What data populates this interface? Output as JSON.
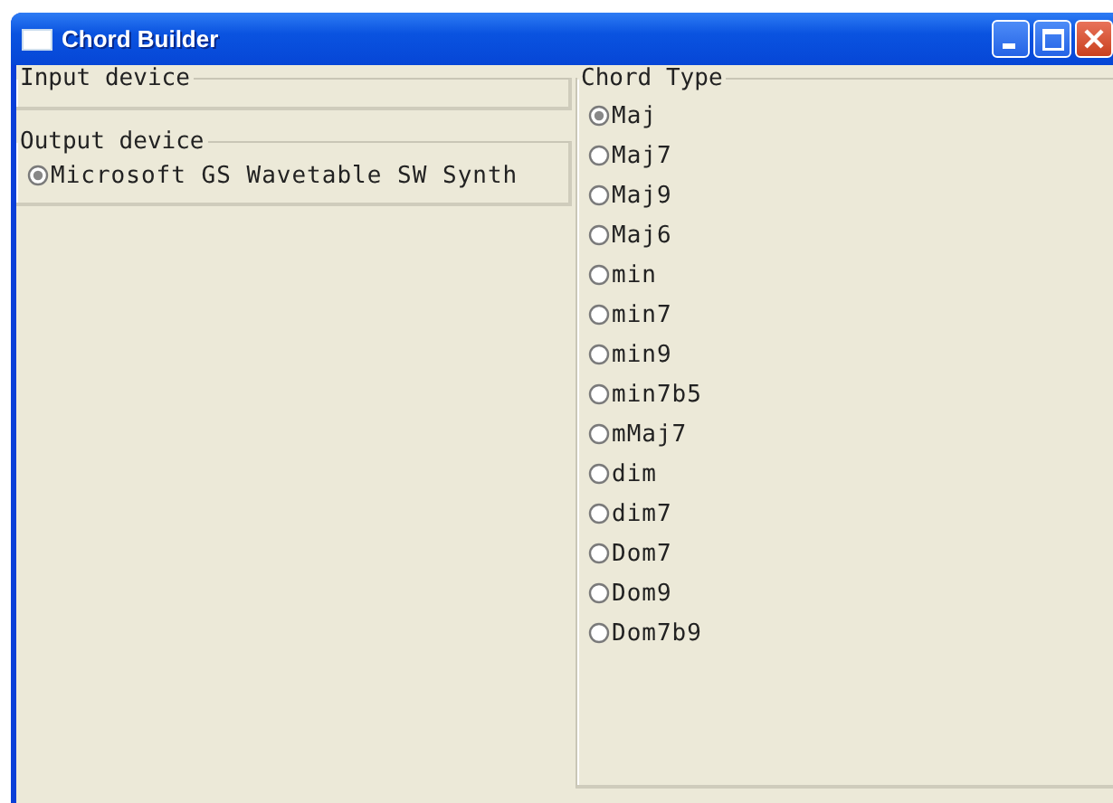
{
  "window": {
    "title": "Chord Builder"
  },
  "input_device": {
    "label": "Input device"
  },
  "output_device": {
    "label": "Output device",
    "options": [
      {
        "label": "Microsoft GS Wavetable SW Synth",
        "selected": true
      }
    ]
  },
  "chord_type": {
    "label": "Chord Type",
    "options": [
      {
        "label": "Maj",
        "selected": true
      },
      {
        "label": "Maj7",
        "selected": false
      },
      {
        "label": "Maj9",
        "selected": false
      },
      {
        "label": "Maj6",
        "selected": false
      },
      {
        "label": "min",
        "selected": false
      },
      {
        "label": "min7",
        "selected": false
      },
      {
        "label": "min9",
        "selected": false
      },
      {
        "label": "min7b5",
        "selected": false
      },
      {
        "label": "mMaj7",
        "selected": false
      },
      {
        "label": "dim",
        "selected": false
      },
      {
        "label": "dim7",
        "selected": false
      },
      {
        "label": "Dom7",
        "selected": false
      },
      {
        "label": "Dom9",
        "selected": false
      },
      {
        "label": "Dom7b9",
        "selected": false
      }
    ]
  }
}
